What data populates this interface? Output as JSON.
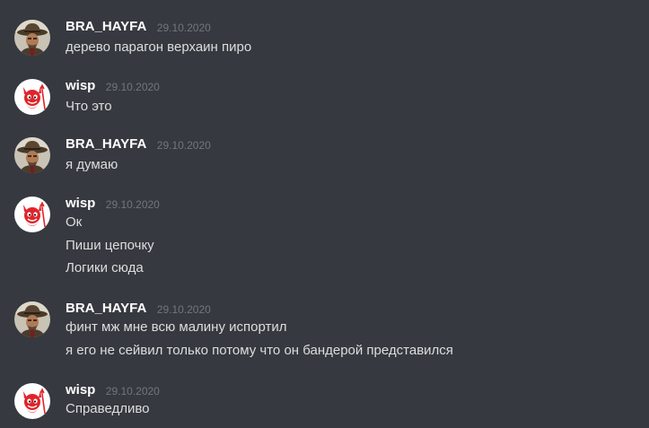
{
  "messages": [
    {
      "author": "BRA_HAYFA",
      "avatar_icon": "cowboy-avatar-icon",
      "timestamp": "29.10.2020",
      "lines": [
        "дерево парагон верхаин пиро"
      ]
    },
    {
      "author": "wisp",
      "avatar_icon": "red-devil-avatar-icon",
      "timestamp": "29.10.2020",
      "lines": [
        "Что это"
      ]
    },
    {
      "author": "BRA_HAYFA",
      "avatar_icon": "cowboy-avatar-icon",
      "timestamp": "29.10.2020",
      "lines": [
        "я думаю"
      ]
    },
    {
      "author": "wisp",
      "avatar_icon": "red-devil-avatar-icon",
      "timestamp": "29.10.2020",
      "lines": [
        "Ок",
        "Пиши цепочку",
        "Логики сюда"
      ]
    },
    {
      "author": "BRA_HAYFA",
      "avatar_icon": "cowboy-avatar-icon",
      "timestamp": "29.10.2020",
      "lines": [
        "финт мж мне всю малину испортил",
        "я его не сейвил только потому что он бандерой представился"
      ]
    },
    {
      "author": "wisp",
      "avatar_icon": "red-devil-avatar-icon",
      "timestamp": "29.10.2020",
      "lines": [
        "Справедливо"
      ]
    }
  ],
  "colors": {
    "background": "#36393f",
    "username": "#ffffff",
    "timestamp": "#72767d",
    "message_text": "#dcddde",
    "devil_red": "#e0242a"
  }
}
